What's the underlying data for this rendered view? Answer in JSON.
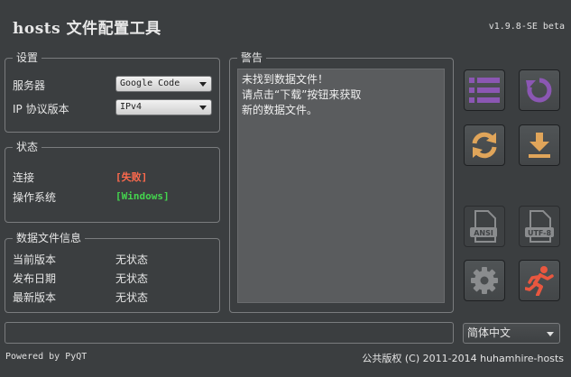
{
  "app": {
    "title": "hosts 文件配置工具",
    "version": "v1.9.8-SE beta"
  },
  "settings": {
    "group_title": "设置",
    "server_label": "服务器",
    "server_value": "Google Code",
    "ip_label": "IP 协议版本",
    "ip_value": "IPv4"
  },
  "status": {
    "group_title": "状态",
    "connection_label": "连接",
    "connection_value": "[失败]",
    "os_label": "操作系统",
    "os_value": "[Windows]",
    "colors": {
      "fail": "#ff6a4d",
      "ok": "#44d54e"
    }
  },
  "datafile": {
    "group_title": "数据文件信息",
    "rows": [
      {
        "label": "当前版本",
        "value": "无状态"
      },
      {
        "label": "发布日期",
        "value": "无状态"
      },
      {
        "label": "最新版本",
        "value": "无状态"
      }
    ]
  },
  "warning": {
    "group_title": "警告",
    "lines": [
      "未找到数据文件！",
      "请点击“下载”按钮来获取",
      "新的数据文件。"
    ]
  },
  "toolbar": {
    "buttons": [
      {
        "name": "list-icon",
        "state": "enabled"
      },
      {
        "name": "refresh-icon",
        "state": "enabled"
      },
      {
        "name": "sync-icon",
        "state": "enabled"
      },
      {
        "name": "download-icon",
        "state": "enabled"
      },
      {
        "name": "ansi-file-icon",
        "state": "disabled",
        "label": "ANSI"
      },
      {
        "name": "utf8-file-icon",
        "state": "disabled",
        "label": "UTF-8"
      },
      {
        "name": "gear-icon",
        "state": "enabled"
      },
      {
        "name": "exit-runner-icon",
        "state": "enabled"
      }
    ],
    "colors": {
      "purple": "#8b57b3",
      "orange": "#e0a55a",
      "red": "#e9573f",
      "gray": "#8a8c8e"
    }
  },
  "footer": {
    "language": "简体中文",
    "powered_by": "Powered by PyQT",
    "copyright": "公共版权 (C) 2011-2014 huhamhire-hosts"
  }
}
